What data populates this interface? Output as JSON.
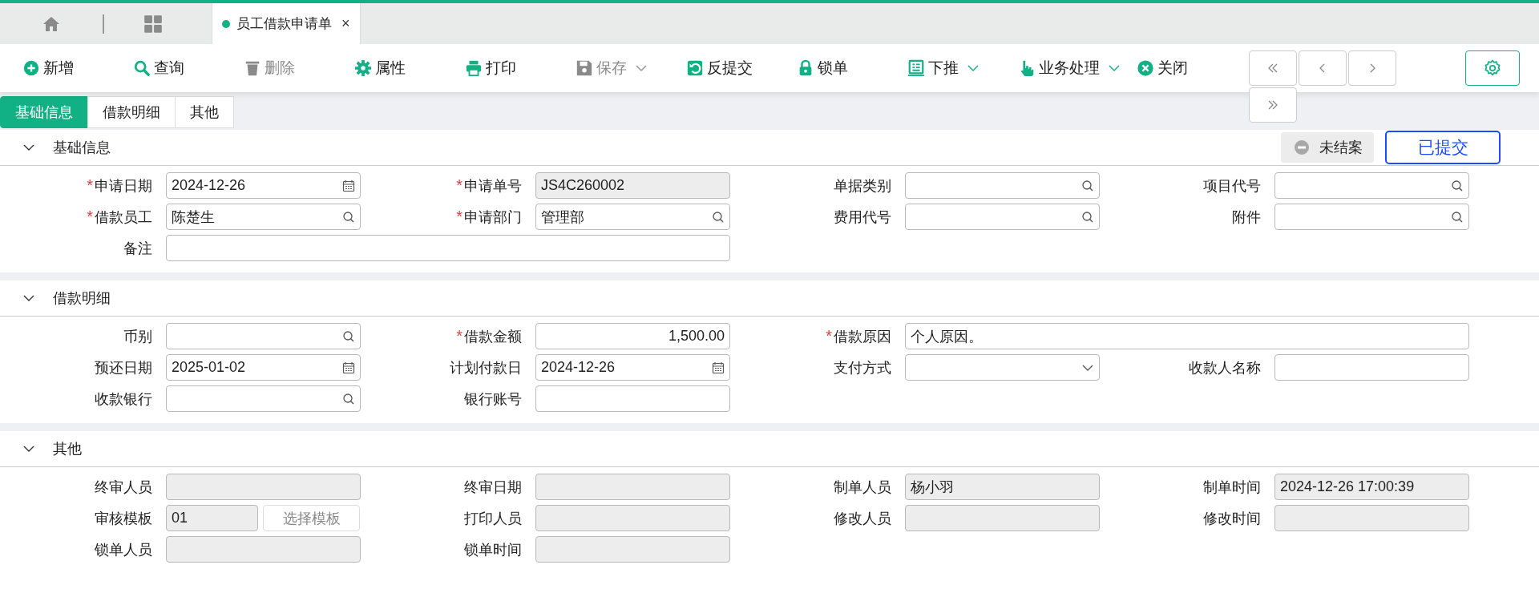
{
  "top_tabs": {
    "document_tab": {
      "title": "员工借款申请单",
      "close": "×"
    }
  },
  "toolbar": [
    {
      "label": "新增",
      "kind": "plus",
      "disabled": false,
      "dropdown": false
    },
    {
      "label": "查询",
      "kind": "search",
      "disabled": false,
      "dropdown": false
    },
    {
      "label": "删除",
      "kind": "trash",
      "disabled": true,
      "dropdown": false
    },
    {
      "label": "属性",
      "kind": "gear",
      "disabled": false,
      "dropdown": false
    },
    {
      "label": "打印",
      "kind": "printer",
      "disabled": false,
      "dropdown": false
    },
    {
      "label": "保存",
      "kind": "save",
      "disabled": true,
      "dropdown": true
    },
    {
      "label": "反提交",
      "kind": "undo",
      "disabled": false,
      "dropdown": false
    },
    {
      "label": "锁单",
      "kind": "lock",
      "disabled": false,
      "dropdown": false
    },
    {
      "label": "下推",
      "kind": "list",
      "disabled": false,
      "dropdown": true
    },
    {
      "label": "业务处理",
      "kind": "hand",
      "disabled": false,
      "dropdown": true
    },
    {
      "label": "关闭",
      "kind": "close",
      "disabled": false,
      "dropdown": false
    }
  ],
  "form_tabs": [
    {
      "label": "基础信息",
      "selected": true
    },
    {
      "label": "借款明细",
      "selected": false
    },
    {
      "label": "其他",
      "selected": false
    }
  ],
  "status": {
    "closed_badge": "未结案",
    "submitted_button": "已提交"
  },
  "sections": [
    {
      "title": "基础信息",
      "expanded": true,
      "fields": [
        {
          "label": "申请日期",
          "marker": "*",
          "kind": "date",
          "value": "2024-12-26"
        },
        {
          "label": "申请单号",
          "marker": "*",
          "kind": "readonly",
          "value": "JS4C260002"
        },
        {
          "label": "单据类别",
          "kind": "lookup"
        },
        {
          "label": "项目代号",
          "kind": "lookup"
        },
        {
          "label": "借款员工",
          "marker": "*",
          "kind": "lookup",
          "value": "陈楚生"
        },
        {
          "label": "申请部门",
          "marker": "*",
          "kind": "lookup",
          "value": "管理部"
        },
        {
          "label": "费用代号",
          "kind": "lookup"
        },
        {
          "label": "附件",
          "kind": "lookup"
        },
        {
          "label": "备注",
          "kind": "text",
          "wide": true
        }
      ]
    },
    {
      "title": "借款明细",
      "expanded": true,
      "fields": [
        {
          "label": "币别",
          "kind": "lookup"
        },
        {
          "label": "借款金额",
          "marker": "*",
          "kind": "amount",
          "value": "1,500.00"
        },
        {
          "label": "借款原因",
          "marker": "*",
          "kind": "text",
          "value": "个人原因。",
          "wide": true
        },
        {
          "label": "预还日期",
          "kind": "date",
          "value": "2025-01-02"
        },
        {
          "label": "计划付款日",
          "kind": "date",
          "value": "2024-12-26"
        },
        {
          "label": "支付方式",
          "kind": "select"
        },
        {
          "label": "收款人名称",
          "kind": "text"
        },
        {
          "label": "收款银行",
          "kind": "lookup"
        },
        {
          "label": "银行账号",
          "kind": "text"
        }
      ]
    },
    {
      "title": "其他",
      "expanded": true,
      "fields": [
        {
          "label": "终审人员",
          "kind": "readonly"
        },
        {
          "label": "终审日期",
          "kind": "readonly"
        },
        {
          "label": "制单人员",
          "kind": "readonly",
          "value": "杨小羽"
        },
        {
          "label": "制单时间",
          "kind": "readonly",
          "value": "2024-12-26 17:00:39"
        },
        {
          "label": "审核模板",
          "kind": "template",
          "value": "01",
          "button": "选择模板"
        },
        {
          "label": "打印人员",
          "kind": "readonly"
        },
        {
          "label": "修改人员",
          "kind": "readonly"
        },
        {
          "label": "修改时间",
          "kind": "readonly"
        },
        {
          "label": "锁单人员",
          "kind": "readonly"
        },
        {
          "label": "锁单时间",
          "kind": "readonly"
        }
      ]
    }
  ]
}
